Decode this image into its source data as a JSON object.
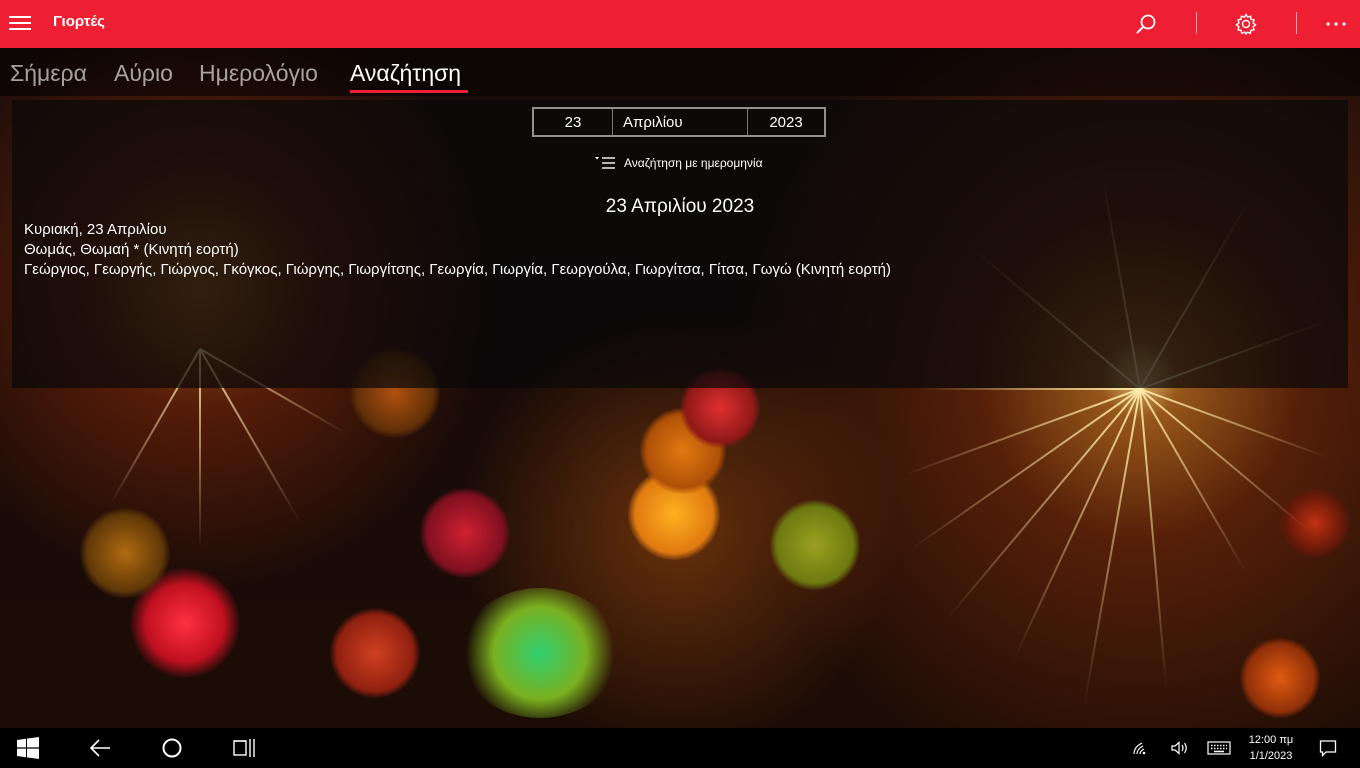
{
  "app": {
    "title": "Γιορτές"
  },
  "colors": {
    "accent": "#ee1f33",
    "taskbar": "#000000"
  },
  "pivot": {
    "tabs": [
      {
        "label": "Σήμερα"
      },
      {
        "label": "Αύριο"
      },
      {
        "label": "Ημερολόγιο"
      },
      {
        "label": "Αναζήτηση"
      }
    ],
    "selected": "Αναζήτηση"
  },
  "search": {
    "day": "23",
    "month": "Απριλίου",
    "year": "2023",
    "search_by_date_label": "Αναζήτηση με ημερομηνία"
  },
  "result": {
    "heading": "23 Απριλίου 2023",
    "lines": [
      "Κυριακή, 23 Απριλίου",
      "Θωμάς, Θωμαή * (Κινητή εορτή)",
      "Γεώργιος, Γεωργής, Γιώργος, Γκόγκος, Γιώργης, Γιωργίτσης, Γεωργία, Γιωργία, Γεωργούλα, Γιωργίτσα, Γίτσα, Γωγώ (Κινητή εορτή)"
    ]
  },
  "taskbar": {
    "time": "12:00 πμ",
    "date": "1/1/2023"
  },
  "icons": {
    "menu": "hamburger-icon",
    "search": "search-icon",
    "settings": "gear-icon",
    "more": "more-icon"
  }
}
